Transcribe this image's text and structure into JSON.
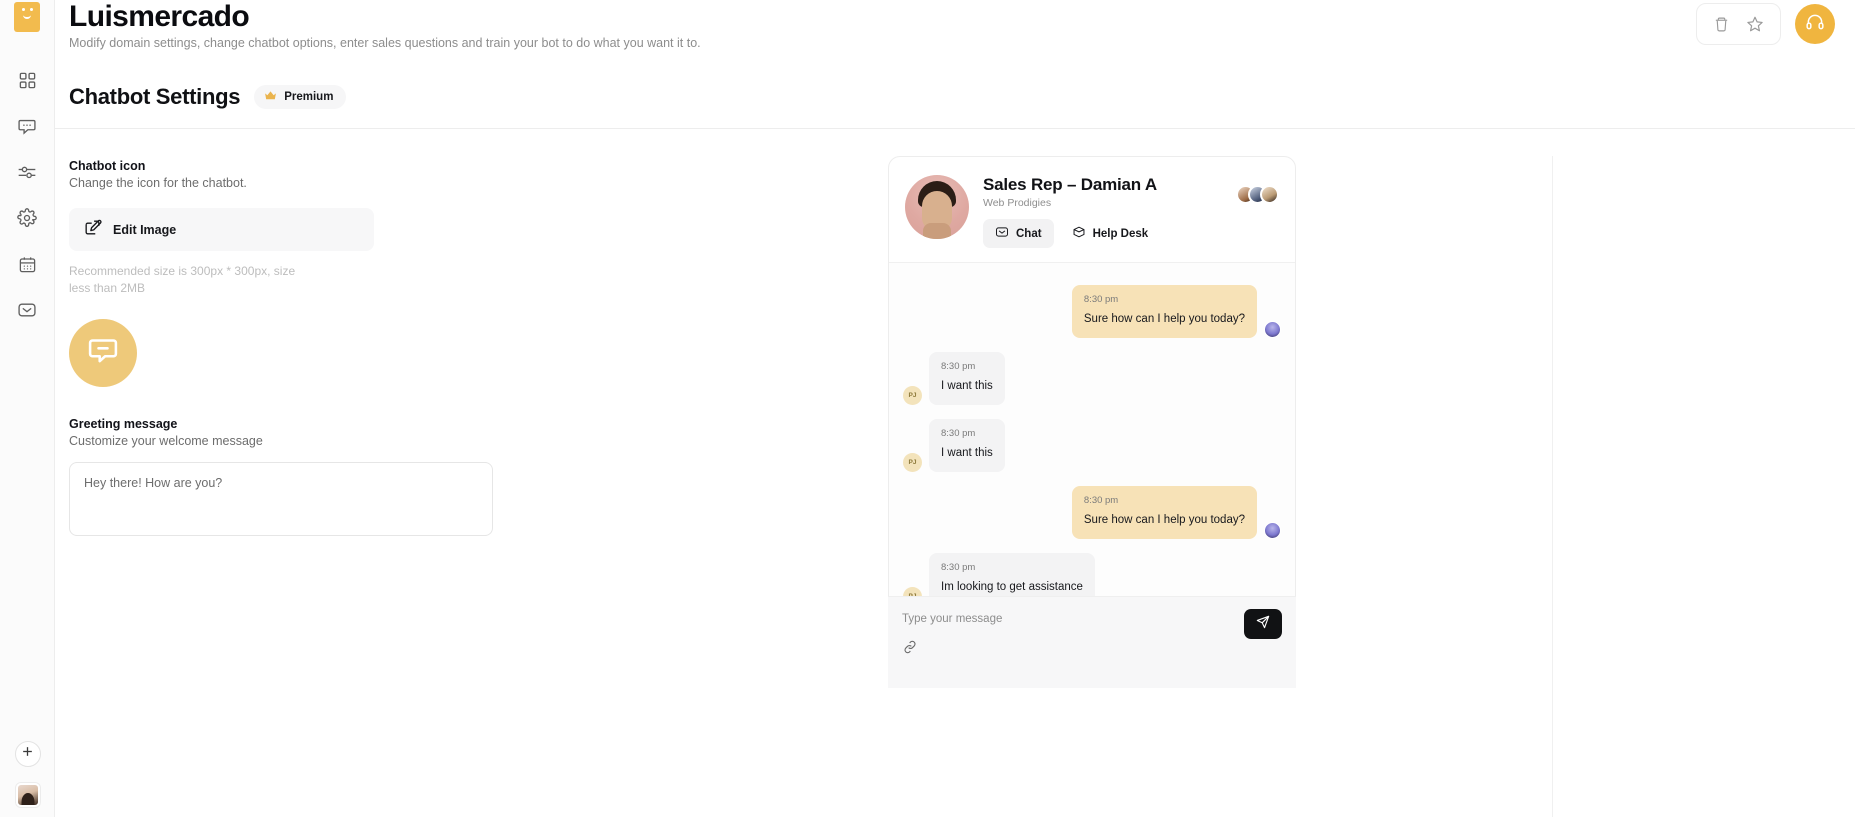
{
  "brand": {
    "logo_name": "luismercado-logo"
  },
  "sidebar": {
    "items": [
      {
        "icon": "grid-icon",
        "name": "dashboard"
      },
      {
        "icon": "chat-bubble-icon",
        "name": "conversations"
      },
      {
        "icon": "sliders-icon",
        "name": "integrations"
      },
      {
        "icon": "gear-icon",
        "name": "settings"
      },
      {
        "icon": "calendar-icon",
        "name": "appointments"
      },
      {
        "icon": "mail-icon",
        "name": "email-marketing"
      }
    ],
    "add_label": "+",
    "avatar_name": "user-avatar"
  },
  "header": {
    "title": "Luismercado",
    "subtitle": "Modify domain settings, change chatbot options, enter sales questions and train your bot to do what you want it to.",
    "delete_icon": "trash-icon",
    "favorite_icon": "star-icon",
    "support_icon": "headphones-icon"
  },
  "section": {
    "title": "Chatbot Settings",
    "badge_label": "Premium",
    "badge_icon": "crown-icon"
  },
  "chatbot_icon": {
    "label": "Chatbot icon",
    "description": "Change the icon for the chatbot.",
    "edit_button_label": "Edit Image",
    "edit_button_icon": "edit-square-icon",
    "hint": "Recommended size is 300px * 300px, size less than 2MB",
    "preview_icon": "chat-bubble-icon"
  },
  "greeting": {
    "label": "Greeting message",
    "description": "Customize your welcome message",
    "placeholder": "Hey there! How are you?",
    "value": ""
  },
  "chat_preview": {
    "rep_name": "Sales Rep – Damian A",
    "org": "Web Prodigies",
    "tabs": [
      {
        "label": "Chat",
        "icon": "mail-icon",
        "active": true
      },
      {
        "label": "Help Desk",
        "icon": "package-icon",
        "active": false
      }
    ],
    "messages": [
      {
        "sender": "bot",
        "time": "8:30 pm",
        "text": "Sure how can I help you today?"
      },
      {
        "sender": "user",
        "time": "8:30 pm",
        "text": "I want this",
        "initials": "PJ"
      },
      {
        "sender": "user",
        "time": "8:30 pm",
        "text": "I want this",
        "initials": "PJ"
      },
      {
        "sender": "bot",
        "time": "8:30 pm",
        "text": "Sure how can I help you today?"
      },
      {
        "sender": "user",
        "time": "8:30 pm",
        "text": "Im looking to get assistance",
        "initials": "PJ"
      }
    ],
    "input_placeholder": "Type your message",
    "send_icon": "send-icon",
    "attach_icon": "link-icon"
  },
  "colors": {
    "brand_gold": "#f0b53f",
    "bot_bubble": "#f7e2b7",
    "user_bubble": "#f3f3f4",
    "send_button": "#111214"
  }
}
